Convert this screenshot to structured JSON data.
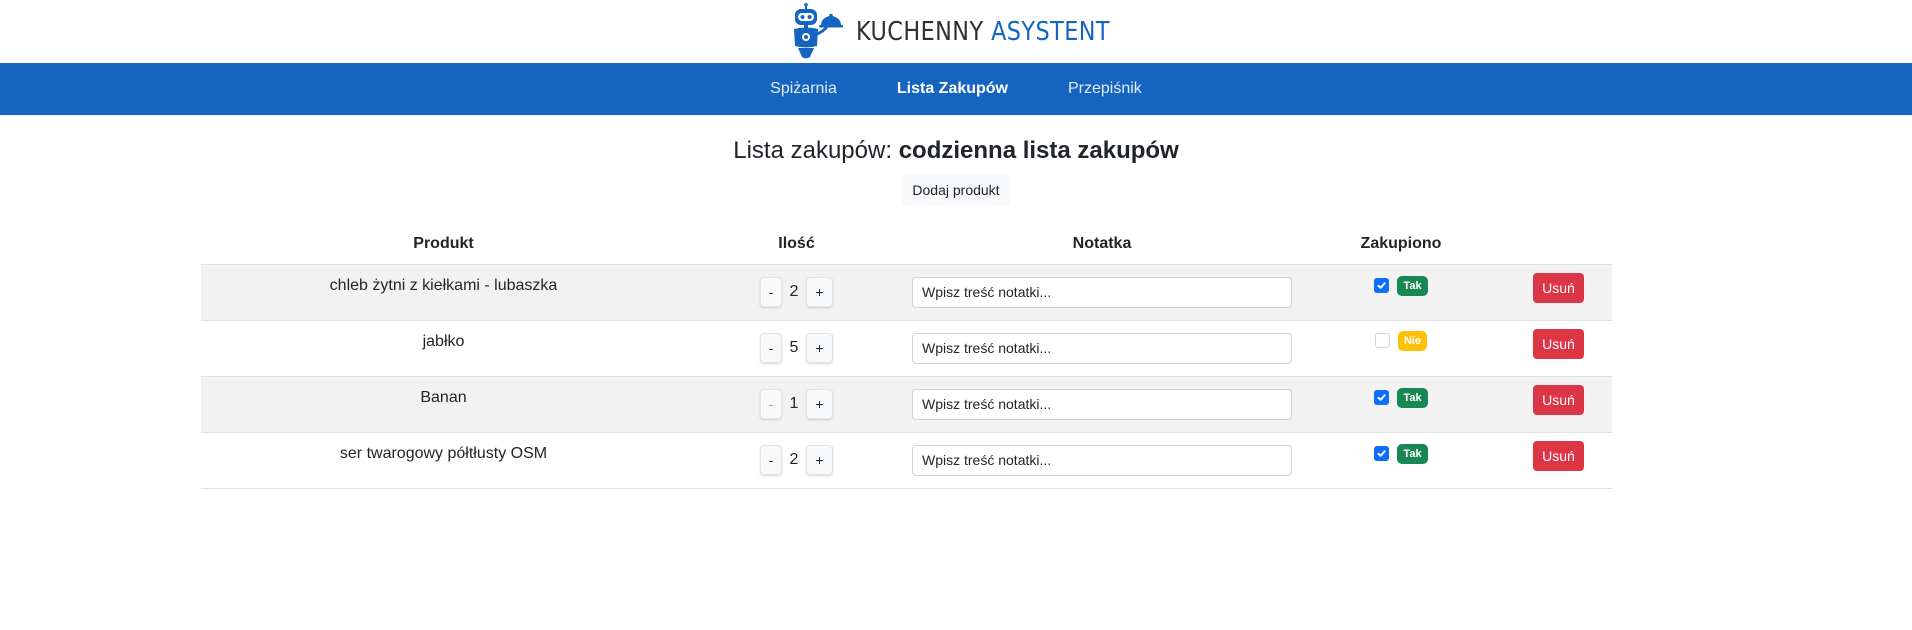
{
  "logo": {
    "part1": "KUCHENNY",
    "part2": "ASYSTENT"
  },
  "nav": [
    {
      "label": "Spiżarnia",
      "active": false
    },
    {
      "label": "Lista Zakupów",
      "active": true
    },
    {
      "label": "Przepiśnik",
      "active": false
    }
  ],
  "page": {
    "title_prefix": "Lista zakupów:",
    "title_name": "codzienna lista zakupów",
    "add_button": "Dodaj produkt"
  },
  "table": {
    "headers": {
      "product": "Produkt",
      "qty": "Ilość",
      "note": "Notatka",
      "bought": "Zakupiono"
    },
    "note_placeholder": "Wpisz treść notatki...",
    "minus_label": "-",
    "plus_label": "+",
    "delete_label": "Usuń",
    "rows": [
      {
        "product": "chleb żytni z kiełkami - lubaszka",
        "qty": "2",
        "bought": true,
        "bought_label": "Tak"
      },
      {
        "product": "jabłko",
        "qty": "5",
        "bought": false,
        "bought_label": "Nie"
      },
      {
        "product": "Banan",
        "qty": "1",
        "bought": true,
        "bought_label": "Tak"
      },
      {
        "product": "ser twarogowy półtłusty OSM",
        "qty": "2",
        "bought": true,
        "bought_label": "Tak"
      }
    ]
  },
  "colors": {
    "primary": "#1565c0",
    "yes": "#198754",
    "no": "#ffc107",
    "danger": "#dc3545",
    "checkbox": "#0d6efd"
  }
}
